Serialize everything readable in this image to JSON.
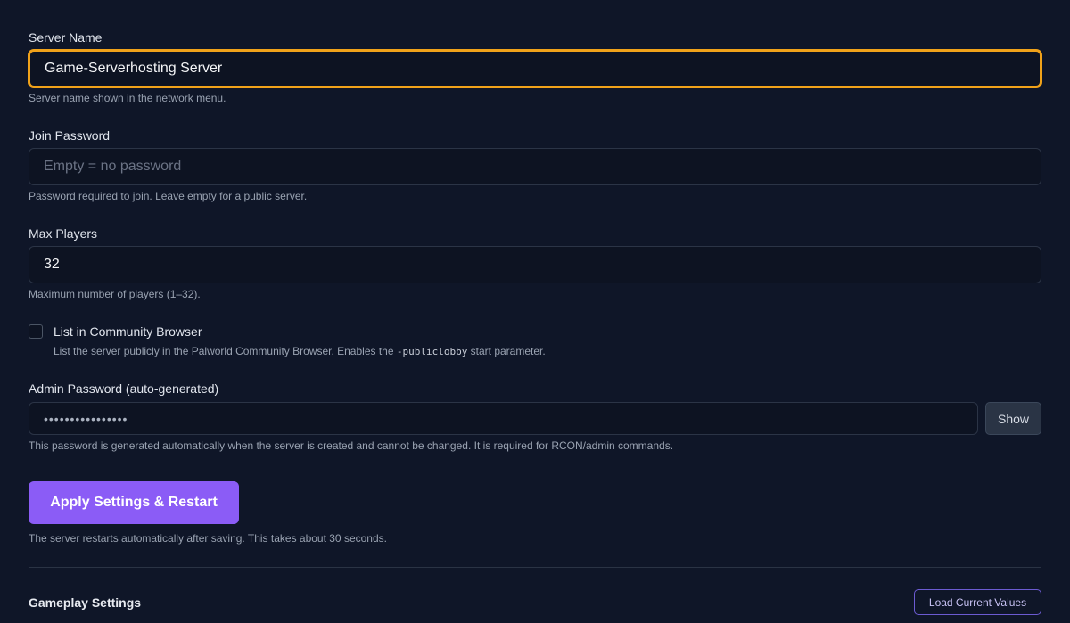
{
  "server_name": {
    "label": "Server Name",
    "value": "Game-Serverhosting Server",
    "hint": "Server name shown in the network menu."
  },
  "join_password": {
    "label": "Join Password",
    "value": "",
    "placeholder": "Empty = no password",
    "hint": "Password required to join. Leave empty for a public server."
  },
  "max_players": {
    "label": "Max Players",
    "value": "32",
    "hint": "Maximum number of players (1–32)."
  },
  "community": {
    "label": "List in Community Browser",
    "checked": false,
    "hint_before": "List the server publicly in the Palworld Community Browser. Enables the ",
    "hint_code": "-publiclobby",
    "hint_after": " start parameter."
  },
  "admin_password": {
    "label": "Admin Password (auto-generated)",
    "masked_value": "••••••••••••••••",
    "show_label": "Show",
    "hint": "This password is generated automatically when the server is created and cannot be changed. It is required for RCON/admin commands."
  },
  "apply": {
    "label": "Apply Settings & Restart",
    "hint": "The server restarts automatically after saving. This takes about 30 seconds."
  },
  "gameplay": {
    "title": "Gameplay Settings",
    "load_label": "Load Current Values"
  },
  "colors": {
    "background": "#0f1628",
    "focus_ring": "#f0a21a",
    "accent": "#8b5cf6"
  }
}
